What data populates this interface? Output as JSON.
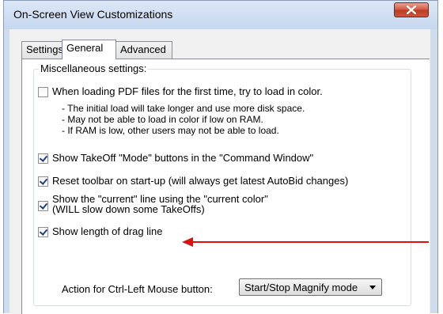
{
  "window": {
    "title": "On-Screen View Customizations"
  },
  "tabs": [
    {
      "label": "Settings",
      "active": false
    },
    {
      "label": "General",
      "active": true
    },
    {
      "label": "Advanced",
      "active": false
    }
  ],
  "group": {
    "label": "Miscellaneous settings:",
    "checkboxes": [
      {
        "label": "When loading PDF files for the first time, try to load in color.",
        "checked": false
      },
      {
        "label": "Show TakeOff \"Mode\" buttons in the \"Command Window\"",
        "checked": true
      },
      {
        "label": "Reset toolbar on start-up (will always get latest AutoBid changes)",
        "checked": true
      },
      {
        "label_line1": "Show the \"current\" line using the \"current color\"",
        "label_line2": "(WILL slow down some TakeOffs)",
        "checked": true
      },
      {
        "label": "Show length of drag line",
        "checked": true
      }
    ],
    "notes": [
      "- The initial load will take longer and use more disk space.",
      "- May not be able to load in color if low on RAM.",
      "- If RAM is low, other users may not be able to load."
    ],
    "action_label": "Action for Ctrl-Left Mouse button:",
    "action_value": "Start/Stop Magnify mode"
  },
  "colors": {
    "annotation_arrow": "#e01010",
    "close_button": "#c8553d"
  },
  "icons": {
    "close": "close-icon",
    "dropdown": "chevron-down-icon",
    "annotation": "arrow-left-icon"
  }
}
